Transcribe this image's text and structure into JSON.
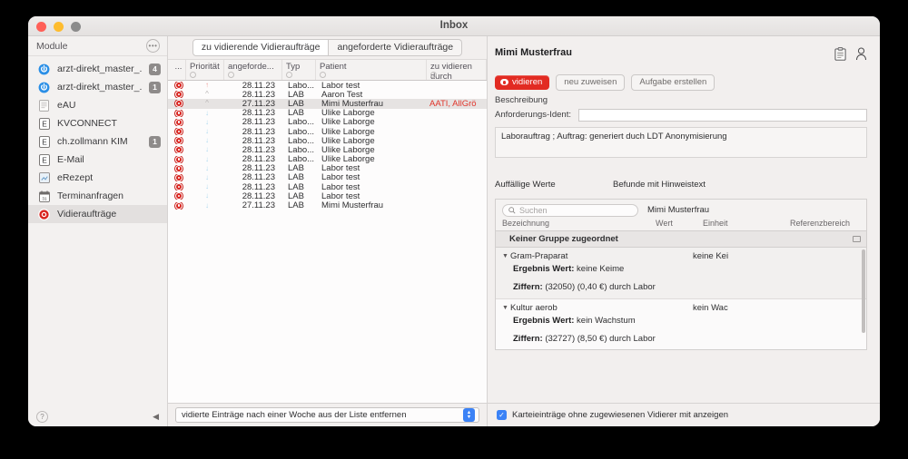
{
  "window": {
    "title": "Inbox",
    "traffic_lights": [
      "close",
      "minimize",
      "zoom"
    ]
  },
  "sidebar": {
    "header": "Module",
    "more_icon": "ellipsis-icon",
    "items": [
      {
        "label": "arzt-direkt_master_...",
        "icon": "arzt-direkt-icon",
        "badge": "4",
        "selected": false
      },
      {
        "label": "arzt-direkt_master_...",
        "icon": "arzt-direkt-icon",
        "badge": "1",
        "selected": false
      },
      {
        "label": "eAU",
        "icon": "document-icon",
        "badge": "",
        "selected": false
      },
      {
        "label": "KVCONNECT",
        "icon": "e-box-icon",
        "badge": "",
        "selected": false
      },
      {
        "label": "ch.zollmann KIM",
        "icon": "e-box-icon",
        "badge": "1",
        "selected": false
      },
      {
        "label": "E-Mail",
        "icon": "e-box-icon",
        "badge": "",
        "selected": false
      },
      {
        "label": "eRezept",
        "icon": "prescription-icon",
        "badge": "",
        "selected": false
      },
      {
        "label": "Terminanfragen",
        "icon": "calendar-icon",
        "badge": "",
        "selected": false
      },
      {
        "label": "Vidieraufträge",
        "icon": "stop-sign-icon",
        "badge": "",
        "selected": true
      }
    ],
    "footer": {
      "help_icon": "question-mark-icon",
      "collapse_icon": "triangle-left-icon"
    }
  },
  "list_panel": {
    "tabs": [
      {
        "label": "zu vidierende Vidieraufträge",
        "active": true
      },
      {
        "label": "angeforderte Vidieraufträge",
        "active": false
      }
    ],
    "columns": [
      "...",
      "Priorität",
      "angeforde...",
      "Typ",
      "Patient",
      "zu vidieren durch"
    ],
    "rows": [
      {
        "prio": "up-red",
        "date": "28.11.23",
        "typ": "Labo...",
        "patient": "Labor test",
        "vidierer": "",
        "selected": false
      },
      {
        "prio": "chev",
        "date": "28.11.23",
        "typ": "LAB",
        "patient": "Aaron Test",
        "vidierer": "",
        "selected": false
      },
      {
        "prio": "chev",
        "date": "27.11.23",
        "typ": "LAB",
        "patient": "Mimi Musterfrau",
        "vidierer": "AATI, AllGrö",
        "selected": true
      },
      {
        "prio": "down",
        "date": "28.11.23",
        "typ": "LAB",
        "patient": "Ulike Laborge",
        "vidierer": "",
        "selected": false
      },
      {
        "prio": "down",
        "date": "28.11.23",
        "typ": "Labo...",
        "patient": "Ulike Laborge",
        "vidierer": "",
        "selected": false
      },
      {
        "prio": "down",
        "date": "28.11.23",
        "typ": "Labo...",
        "patient": "Ulike Laborge",
        "vidierer": "",
        "selected": false
      },
      {
        "prio": "down",
        "date": "28.11.23",
        "typ": "Labo...",
        "patient": "Ulike Laborge",
        "vidierer": "",
        "selected": false
      },
      {
        "prio": "down",
        "date": "28.11.23",
        "typ": "Labo...",
        "patient": "Ulike Laborge",
        "vidierer": "",
        "selected": false
      },
      {
        "prio": "down",
        "date": "28.11.23",
        "typ": "Labo...",
        "patient": "Ulike Laborge",
        "vidierer": "",
        "selected": false
      },
      {
        "prio": "down",
        "date": "28.11.23",
        "typ": "LAB",
        "patient": "Labor test",
        "vidierer": "",
        "selected": false
      },
      {
        "prio": "down",
        "date": "28.11.23",
        "typ": "LAB",
        "patient": "Labor test",
        "vidierer": "",
        "selected": false
      },
      {
        "prio": "down",
        "date": "28.11.23",
        "typ": "LAB",
        "patient": "Labor test",
        "vidierer": "",
        "selected": false
      },
      {
        "prio": "down",
        "date": "28.11.23",
        "typ": "LAB",
        "patient": "Labor test",
        "vidierer": "",
        "selected": false
      },
      {
        "prio": "down",
        "date": "27.11.23",
        "typ": "LAB",
        "patient": "Mimi Musterfrau",
        "vidierer": "",
        "selected": false
      }
    ],
    "footer_popup": "vidierte Einträge nach einer Woche aus der Liste entfernen"
  },
  "detail": {
    "patient_name": "Mimi Musterfrau",
    "icons": [
      "clipboard-icon",
      "person-icon"
    ],
    "buttons": {
      "vidieren": "vidieren",
      "neu_zuweisen": "neu zuweisen",
      "aufgabe_erstellen": "Aufgabe erstellen"
    },
    "beschreibung_label": "Beschreibung",
    "ident_label": "Anforderungs-Ident:",
    "ident_value": "",
    "description_text": "Laborauftrag ; Auftrag: generiert duch LDT Anonymisierung",
    "sub_headers": {
      "auffaellige": "Auffällige Werte",
      "befunde": "Befunde mit Hinweistext"
    },
    "results": {
      "search_placeholder": "Suchen",
      "search_value": "",
      "patient_label": "Mimi Musterfrau",
      "columns": [
        "Bezeichnung",
        "Wert",
        "Einheit",
        "Referenzbereich"
      ],
      "group_header": "Keiner Gruppe zugeordnet",
      "entries": [
        {
          "name": "Gram-Praparat",
          "value": "keine Kei",
          "ergebnis_label": "Ergebnis Wert:",
          "ergebnis_value": "keine Keime",
          "ziffern_label": "Ziffern:",
          "ziffern_value": "(32050) (0,40 €) durch Labor"
        },
        {
          "name": "Kultur aerob",
          "value": "kein Wac",
          "ergebnis_label": "Ergebnis Wert:",
          "ergebnis_value": "kein Wachstum",
          "ziffern_label": "Ziffern:",
          "ziffern_value": "(32727) (8,50 €) durch Labor"
        }
      ]
    },
    "footer_checkbox": {
      "checked": true,
      "label": "Karteieinträge ohne zugewiesenen Vidierer mit anzeigen"
    }
  },
  "colors": {
    "accent_red": "#e22b22",
    "stop_red": "#d9241f",
    "checkbox_blue": "#3b82f6",
    "badge_gray": "#8e8b8a",
    "window_bg": "#ececec"
  }
}
